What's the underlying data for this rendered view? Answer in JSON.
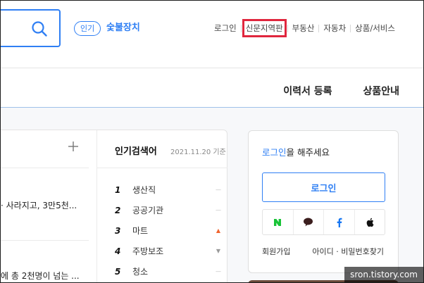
{
  "header": {
    "popular_badge": "인기",
    "popular_keyword": "숯불장치",
    "util_nav": [
      {
        "label": "로그인"
      },
      {
        "label": "신문지역판",
        "highlighted": true
      },
      {
        "label": "부동산"
      },
      {
        "label": "자동차"
      },
      {
        "label": "상품/서비스"
      }
    ]
  },
  "gnb": {
    "items": [
      "이력서 등록",
      "상품안내"
    ]
  },
  "news": {
    "items": [
      "· 사라지고, 3만5천...",
      "에 총 2천명이 넘는 ..."
    ]
  },
  "popular_keywords": {
    "title": "인기검색어",
    "date": "2021.11.20 기준",
    "items": [
      {
        "rank": "1",
        "word": "생산직",
        "trend": "same"
      },
      {
        "rank": "2",
        "word": "공공기관",
        "trend": "same"
      },
      {
        "rank": "3",
        "word": "마트",
        "trend": "up"
      },
      {
        "rank": "4",
        "word": "주방보조",
        "trend": "down"
      },
      {
        "rank": "5",
        "word": "청소",
        "trend": "same"
      }
    ],
    "trend_colors": {
      "up": "#f0642f",
      "down": "#9a9a9a",
      "same": "#bdbdbd"
    }
  },
  "login_box": {
    "message_emphasis": "로그인",
    "message_rest": "을 해주세요",
    "login_button": "로그인",
    "sns": [
      "naver-icon",
      "kakaotalk-icon",
      "facebook-icon",
      "apple-icon"
    ],
    "join_link": "회원가입",
    "find_link": "아이디 · 비밀번호찾기"
  },
  "watermark": "sron.tistory.com",
  "colors": {
    "accent": "#2f7ff4",
    "highlight_box": "#e0263d",
    "naver": "#19c337"
  }
}
